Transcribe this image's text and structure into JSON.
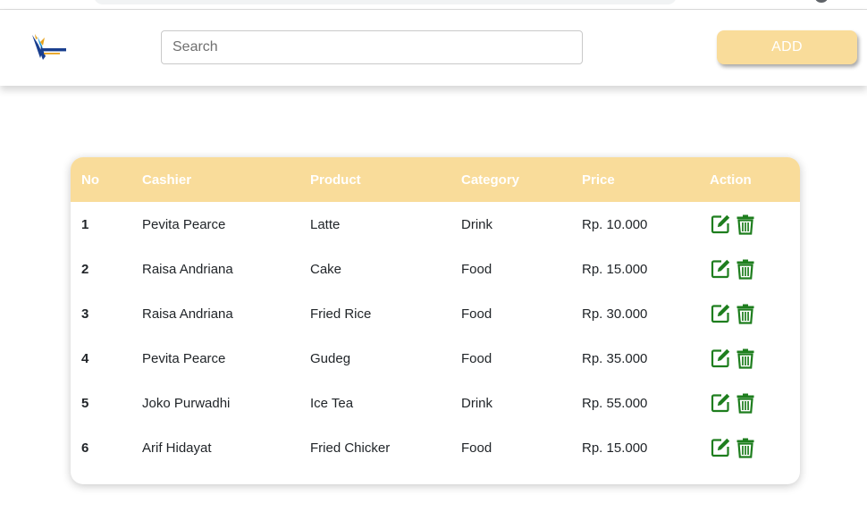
{
  "header": {
    "search_placeholder": "Search",
    "add_label": "ADD"
  },
  "table": {
    "columns": [
      "No",
      "Cashier",
      "Product",
      "Category",
      "Price",
      "Action"
    ],
    "rows": [
      {
        "no": "1",
        "cashier": "Pevita Pearce",
        "product": "Latte",
        "category": "Drink",
        "price": "Rp. 10.000"
      },
      {
        "no": "2",
        "cashier": "Raisa Andriana",
        "product": "Cake",
        "category": "Food",
        "price": "Rp. 15.000"
      },
      {
        "no": "3",
        "cashier": "Raisa Andriana",
        "product": "Fried Rice",
        "category": "Food",
        "price": "Rp. 30.000"
      },
      {
        "no": "4",
        "cashier": "Pevita Pearce",
        "product": "Gudeg",
        "category": "Food",
        "price": "Rp. 35.000"
      },
      {
        "no": "5",
        "cashier": "Joko Purwadhi",
        "product": "Ice Tea",
        "category": "Drink",
        "price": "Rp. 55.000"
      },
      {
        "no": "6",
        "cashier": "Arif Hidayat",
        "product": "Fried Chicker",
        "category": "Food",
        "price": "Rp. 15.000"
      }
    ],
    "row_actions": [
      "edit-icon",
      "trash-icon"
    ]
  },
  "colors": {
    "accent": "#f9dc9a",
    "action_icon": "#1e7e1e",
    "header_text": "#ffffff"
  }
}
